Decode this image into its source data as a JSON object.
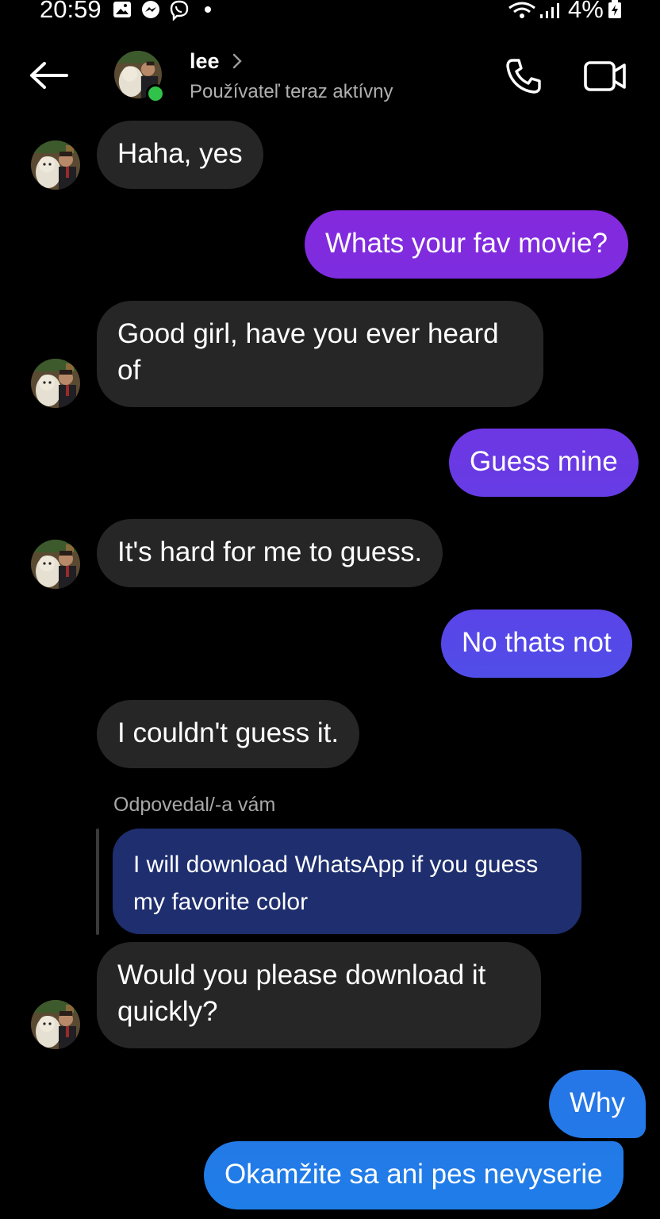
{
  "status_bar": {
    "time": "20:59",
    "battery": "4%",
    "icons": [
      "gallery-icon",
      "messenger-icon",
      "viber-icon",
      "wifi-icon",
      "signal-icon",
      "battery-charging-icon"
    ]
  },
  "header": {
    "contact_name": "lee",
    "contact_status": "Používateľ teraz aktívny",
    "icons": [
      "back-arrow-icon",
      "chevron-right-icon",
      "phone-icon",
      "video-camera-icon"
    ]
  },
  "colors": {
    "background": "#000000",
    "incoming_bubble": "#262626",
    "outgoing_gradient": [
      "#9b1fd6",
      "#7a2ee0",
      "#5a44e8",
      "#2e6de6",
      "#1f7ee8"
    ],
    "reply_bubble": "#1e2e6e",
    "online": "#31c24a"
  },
  "messages": [
    {
      "direction": "incoming",
      "text": "Haha, yes"
    },
    {
      "direction": "outgoing",
      "text": "Whats your fav movie?"
    },
    {
      "direction": "incoming",
      "text": "Good girl, have you ever heard of"
    },
    {
      "direction": "outgoing",
      "text": "Guess mine"
    },
    {
      "direction": "incoming",
      "text": "It's hard for me to guess."
    },
    {
      "direction": "outgoing",
      "text": "No thats not"
    },
    {
      "direction": "incoming",
      "text": "I couldn't guess it."
    },
    {
      "direction": "incoming",
      "reply_label": "Odpovedal/-a vám",
      "quoted_text": "I will  download WhatsApp if you guess my favorite color",
      "text": "Would you please download it quickly?"
    },
    {
      "direction": "outgoing",
      "text": "Why"
    },
    {
      "direction": "outgoing",
      "text": "Okamžite sa ani pes nevyserie"
    }
  ]
}
